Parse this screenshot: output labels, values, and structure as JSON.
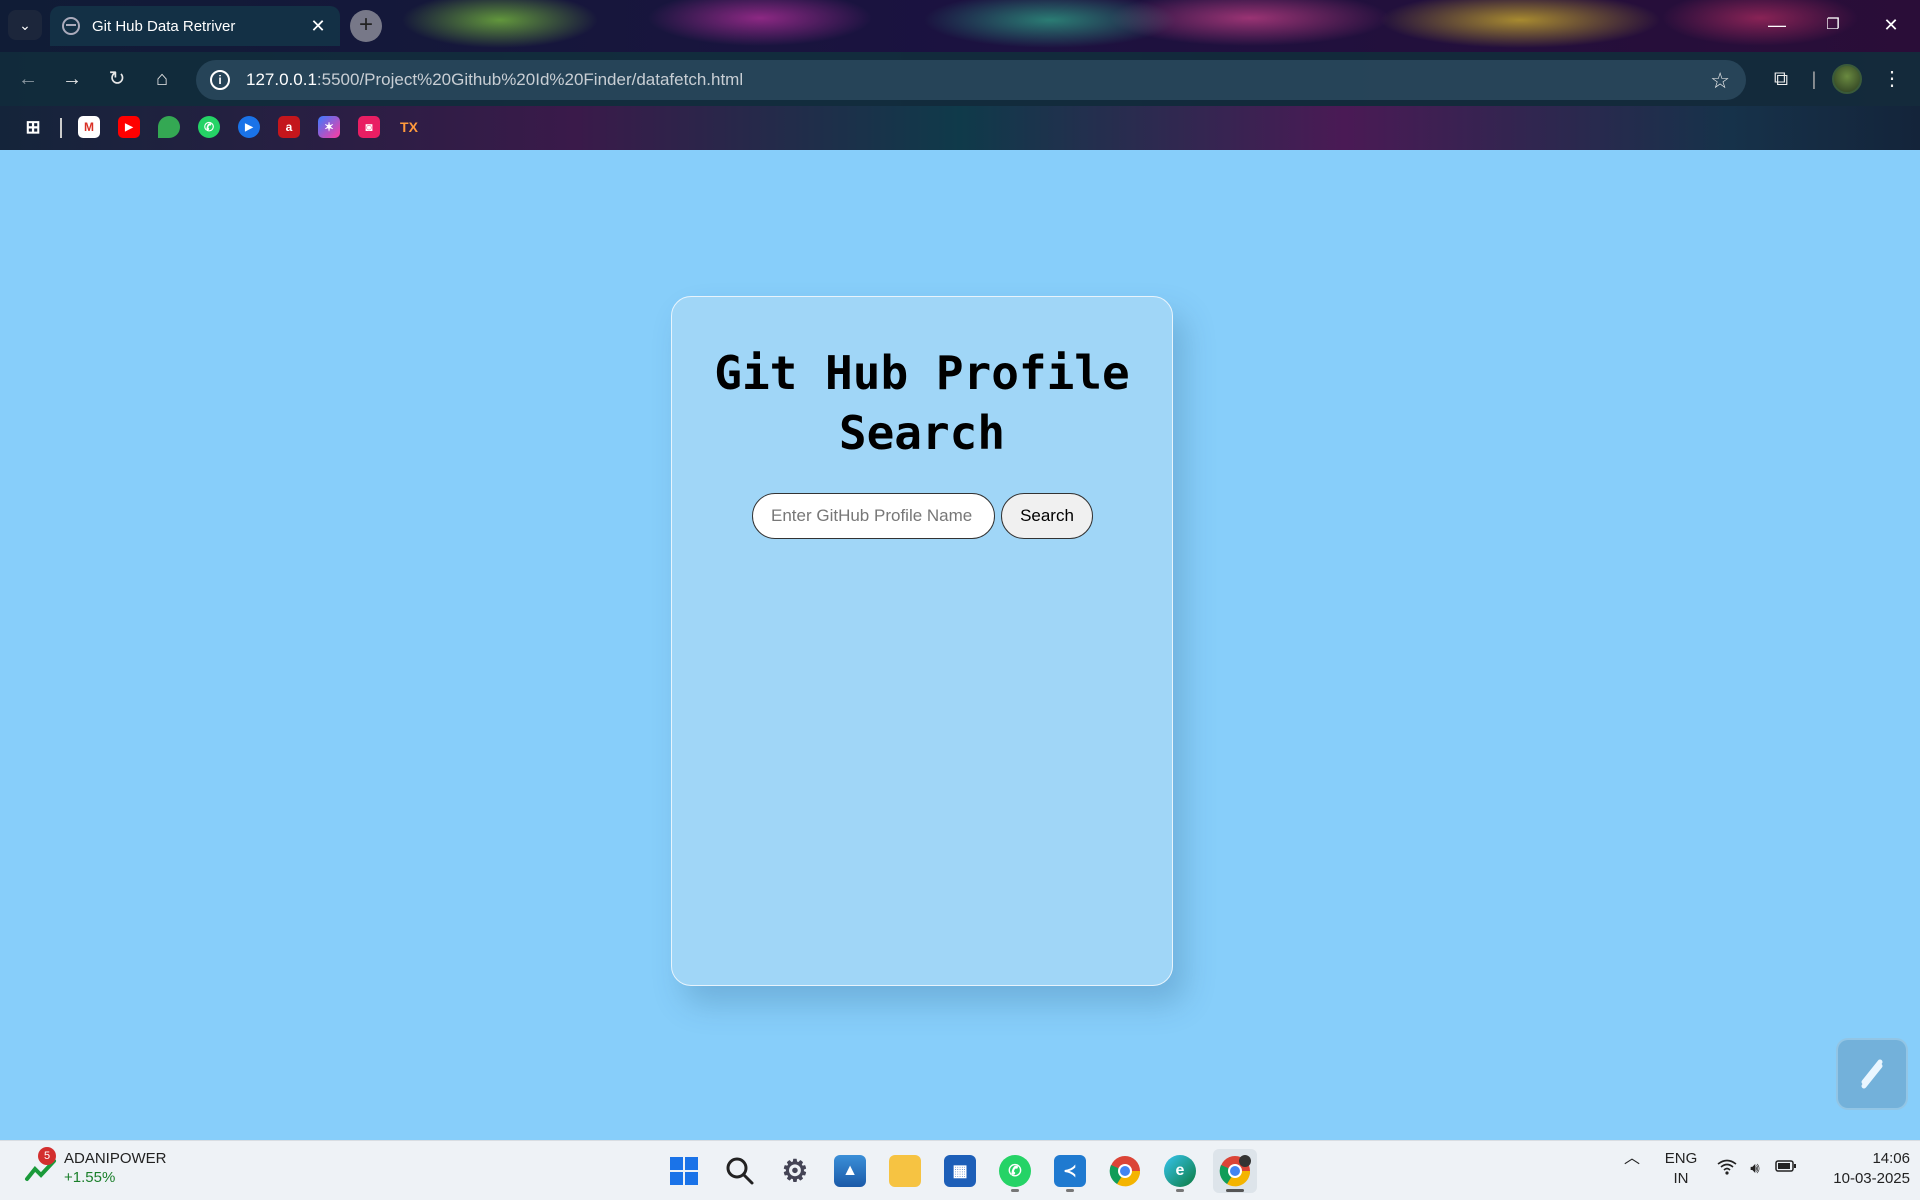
{
  "browser": {
    "tab": {
      "title": "Git Hub Data Retriver",
      "close_glyph": "✕"
    },
    "new_tab_glyph": "+",
    "window_controls": {
      "minimize": "—",
      "restore": "❐",
      "close": "✕"
    },
    "url_host": "127.0.0.1",
    "url_rest": ":5500/Project%20Github%20Id%20Finder/datafetch.html",
    "bookmark_tx": "TX"
  },
  "page": {
    "title_line1": "Git Hub Profile",
    "title_line2": "Search",
    "search_placeholder": "Enter GitHub Profile Name",
    "search_button": "Search",
    "background_color": "#87cefa"
  },
  "taskbar": {
    "stock_badge": "5",
    "stock_name": "ADANIPOWER",
    "stock_change": "+1.55%",
    "lang_line1": "ENG",
    "lang_line2": "IN",
    "time": "14:06",
    "date": "10-03-2025"
  }
}
